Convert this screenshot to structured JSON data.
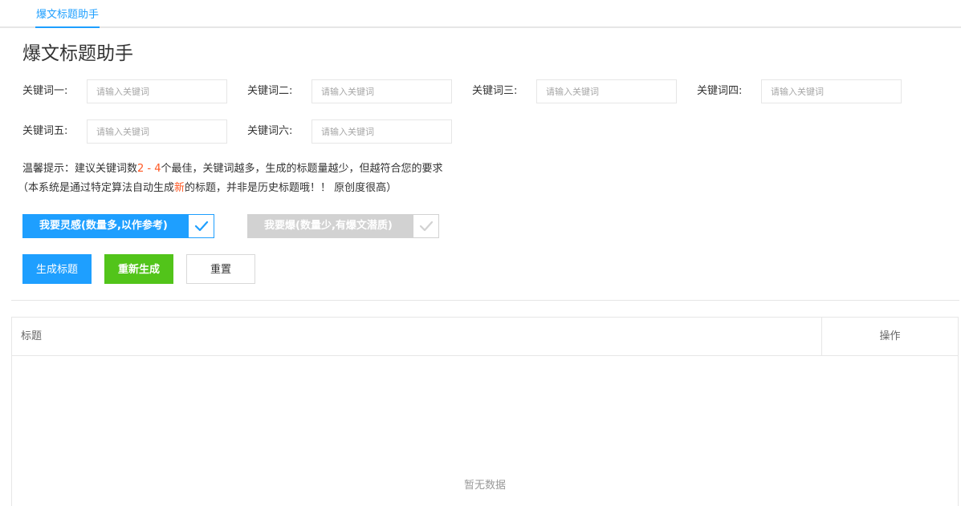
{
  "tab": {
    "label": "爆文标题助手"
  },
  "page": {
    "title": "爆文标题助手"
  },
  "keywords": [
    {
      "label": "关键词一:",
      "placeholder": "请输入关键词",
      "value": ""
    },
    {
      "label": "关键词二:",
      "placeholder": "请输入关键词",
      "value": ""
    },
    {
      "label": "关键词三:",
      "placeholder": "请输入关键词",
      "value": ""
    },
    {
      "label": "关键词四:",
      "placeholder": "请输入关键词",
      "value": ""
    },
    {
      "label": "关键词五:",
      "placeholder": "请输入关键词",
      "value": ""
    },
    {
      "label": "关键词六:",
      "placeholder": "请输入关键词",
      "value": ""
    }
  ],
  "tip": {
    "line1_prefix": "温馨提示：建议关键词数",
    "line1_range": "2 - 4",
    "line1_suffix": "个最佳，关键词越多，生成的标题量越少，但越符合您的要求",
    "line2_prefix": "（本系统是通过特定算法自动生成",
    "line2_highlight": "新",
    "line2_suffix": "的标题，并非是历史标题哦！！ 原创度很高）"
  },
  "modes": {
    "inspire": {
      "label": "我要灵感(数量多,以作参考)",
      "checked": true
    },
    "viral": {
      "label": "我要爆(数量少,有爆文潜质)",
      "checked": false
    }
  },
  "actions": {
    "generate": "生成标题",
    "regenerate": "重新生成",
    "reset": "重置"
  },
  "table": {
    "columns": [
      "标题",
      "操作"
    ],
    "empty_text": "暂无数据"
  },
  "colors": {
    "primary": "#1e9fff",
    "success": "#52c41a",
    "highlight": "#ff5722",
    "disabled": "#d2d2d2"
  }
}
